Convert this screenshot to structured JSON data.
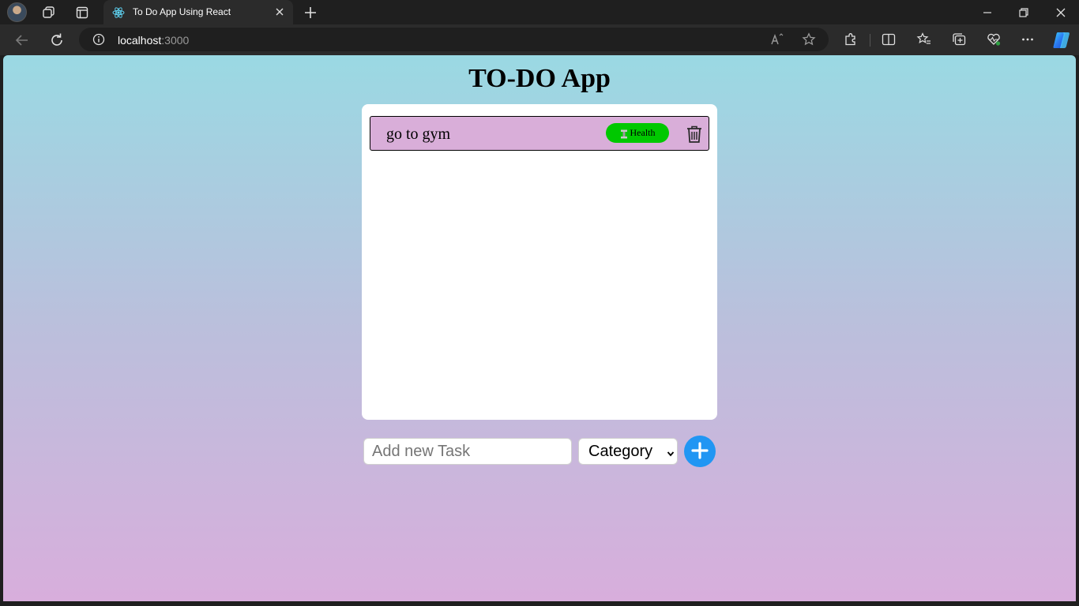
{
  "browser": {
    "tab": {
      "title": "To Do App Using React",
      "favicon": "react-icon"
    },
    "url": {
      "host": "localhost",
      "port": ":3000"
    },
    "icons": {
      "profile": "avatar",
      "workspaces": "workspaces-icon",
      "tab_actions": "tab-actions-icon",
      "new_tab": "plus-icon",
      "back": "back-arrow-icon",
      "refresh": "refresh-icon",
      "site_info": "info-icon",
      "read_aloud": "read-aloud-icon",
      "favorite": "star-icon",
      "extensions": "puzzle-icon",
      "split_screen": "split-screen-icon",
      "favorites": "favorites-icon",
      "collections": "collections-icon",
      "browser_essentials": "heart-pulse-icon",
      "menu": "more-icon",
      "copilot": "copilot-icon"
    }
  },
  "app": {
    "title": "TO-DO App",
    "tasks": [
      {
        "text": "go to gym",
        "category": "Health",
        "category_icon": "dumbbell-icon",
        "category_color": "#00c800"
      }
    ],
    "input": {
      "placeholder": "Add new Task",
      "value": ""
    },
    "category_select": {
      "selected": "Category"
    },
    "add_button_icon": "plus-icon"
  },
  "colors": {
    "task_bg": "#d9aed9",
    "add_button": "#2196f3",
    "gradient_top": "#9ad9e3",
    "gradient_bottom": "#d8aedc"
  }
}
